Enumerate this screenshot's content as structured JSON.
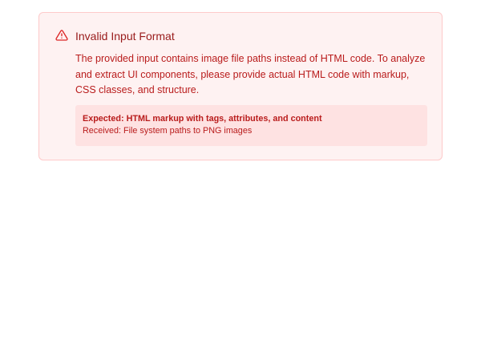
{
  "alert": {
    "icon": "warning-triangle-icon",
    "title": "Invalid Input Format",
    "message": "The provided input contains image file paths instead of HTML code. To analyze and extract UI components, please provide actual HTML code with markup, CSS classes, and structure.",
    "details": {
      "expected": "Expected: HTML markup with tags, attributes, and content",
      "received": "Received: File system paths to PNG images"
    }
  },
  "colors": {
    "background": "#fef2f2",
    "border": "#fecaca",
    "details_background": "#fee2e2",
    "title": "#991b1b",
    "text": "#b91c1c",
    "icon": "#dc2626"
  }
}
